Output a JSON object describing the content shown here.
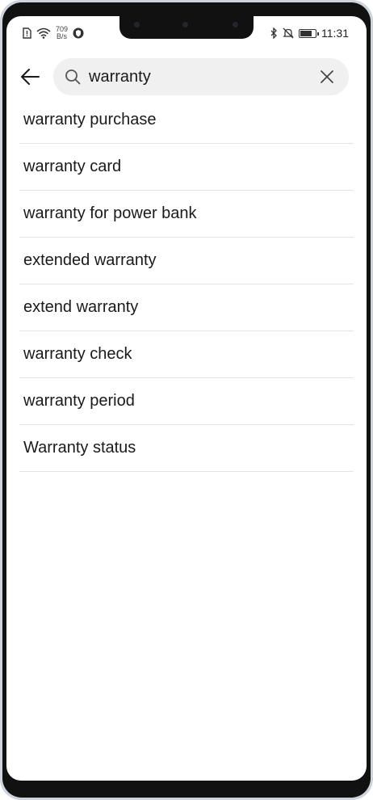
{
  "status_bar": {
    "net_speed_value": "709",
    "net_speed_unit": "B/s",
    "time": "11:31",
    "icons": [
      "sim-alert-icon",
      "wifi-icon",
      "vpn-shield-icon",
      "bluetooth-icon",
      "mute-icon",
      "battery-icon"
    ]
  },
  "search": {
    "query": "warranty",
    "back_icon": "arrow-left-icon",
    "search_icon": "search-icon",
    "clear_icon": "close-icon"
  },
  "suggestions": [
    "warranty purchase",
    "warranty card",
    "warranty for power bank",
    "extended warranty",
    "extend warranty",
    "warranty check",
    "warranty period",
    "Warranty status"
  ],
  "colors": {
    "search_bg": "#f0f0f0",
    "divider": "#e4e4e4",
    "text": "#1a1a1a"
  }
}
